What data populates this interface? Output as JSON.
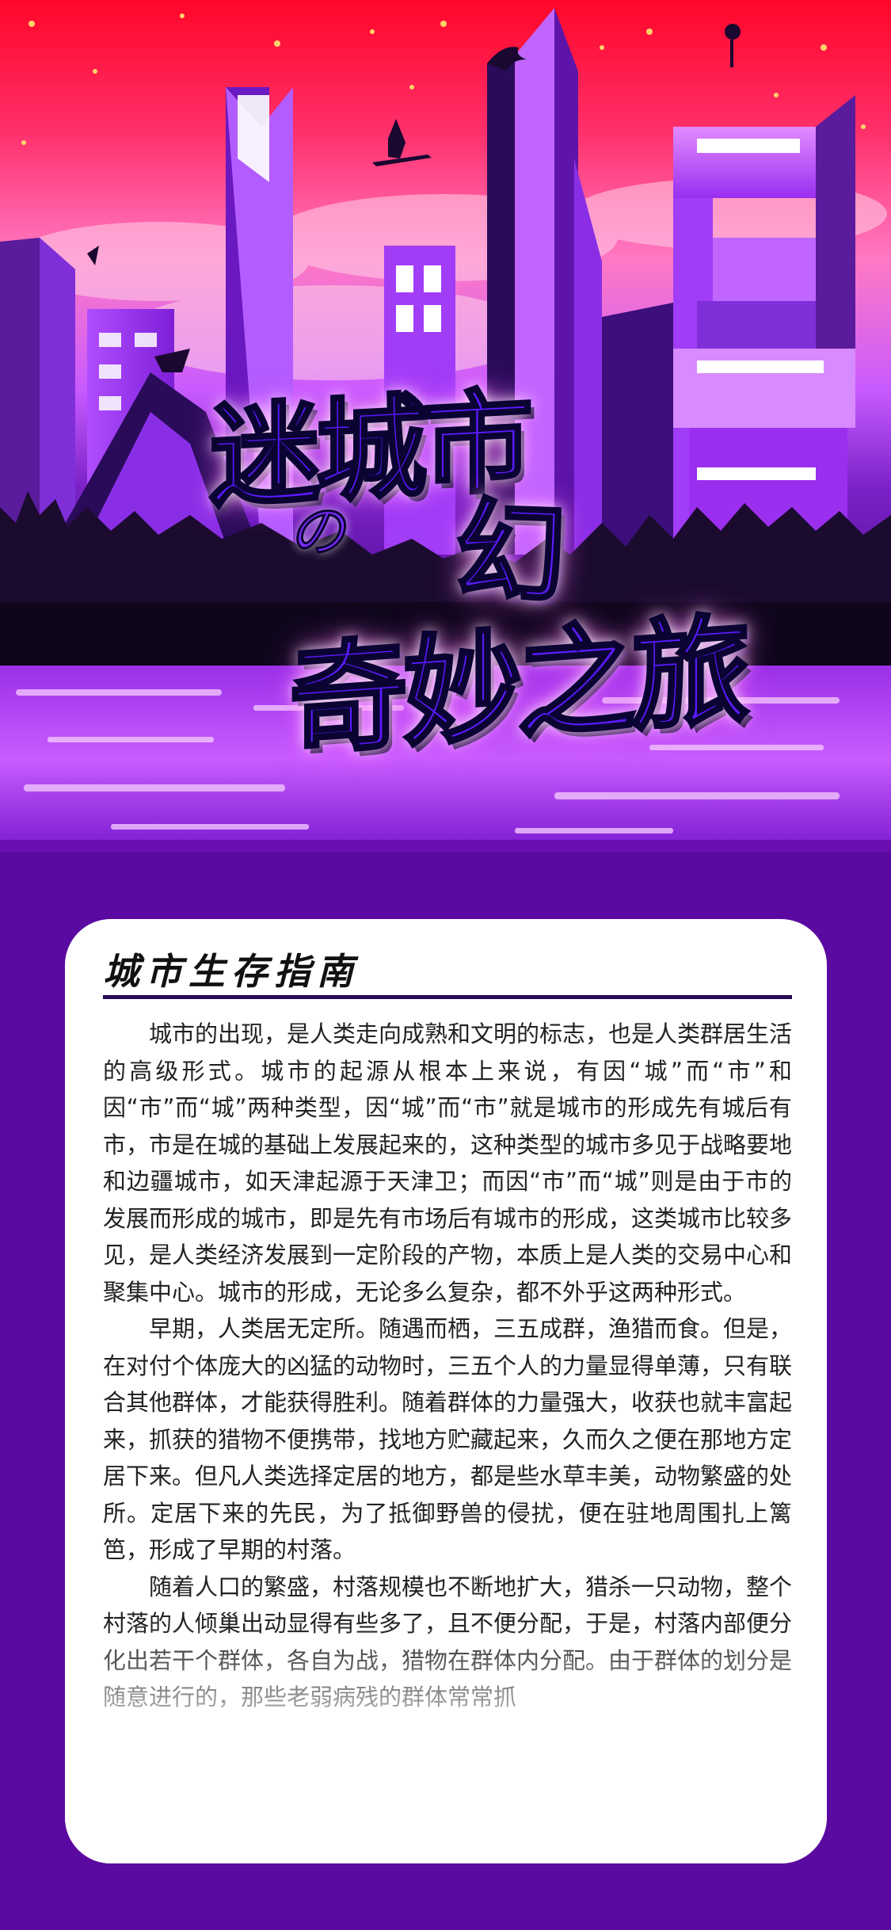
{
  "poster": {
    "title_line1": "迷城市",
    "title_particle": "の",
    "title_line2": "幻",
    "title_line3": "奇妙之旅"
  },
  "article": {
    "heading": "城市生存指南",
    "paragraphs": [
      "城市的出现，是人类走向成熟和文明的标志，也是人类群居生活的高级形式。城市的起源从根本上来说，有因“城”而“市”和因“市”而“城”两种类型，因“城”而“市”就是城市的形成先有城后有市，市是在城的基础上发展起来的，这种类型的城市多见于战略要地和边疆城市，如天津起源于天津卫；而因“市”而“城”则是由于市的发展而形成的城市，即是先有市场后有城市的形成，这类城市比较多见，是人类经济发展到一定阶段的产物，本质上是人类的交易中心和聚集中心。城市的形成，无论多么复杂，都不外乎这两种形式。",
      "早期，人类居无定所。随遇而栖，三五成群，渔猎而食。但是，在对付个体庞大的凶猛的动物时，三五个人的力量显得单薄，只有联合其他群体，才能获得胜利。随着群体的力量强大，收获也就丰富起来，抓获的猎物不便携带，找地方贮藏起来，久而久之便在那地方定居下来。但凡人类选择定居的地方，都是些水草丰美，动物繁盛的处所。定居下来的先民，为了抵御野兽的侵扰，便在驻地周围扎上篱笆，形成了早期的村落。",
      "随着人口的繁盛，村落规模也不断地扩大，猎杀一只动物，整个村落的人倾巢出动显得有些多了，且不便分配，于是，村落内部便分化出若干个群体，各自为战，猎物在群体内分配。由于群体的划分是随意进行的，那些老弱病残的群体常常抓"
    ]
  },
  "colors": {
    "background": "#5a0aa0",
    "sky_top": "#ff0a2a",
    "sky_mid": "#ff5fa8",
    "accent": "#a020f0",
    "card": "#ffffff",
    "rule": "#2a0a55"
  },
  "icons": [
    "witch-on-broom-icon",
    "dragon-icon",
    "balloon-figure-icon",
    "flying-figure-icon"
  ]
}
